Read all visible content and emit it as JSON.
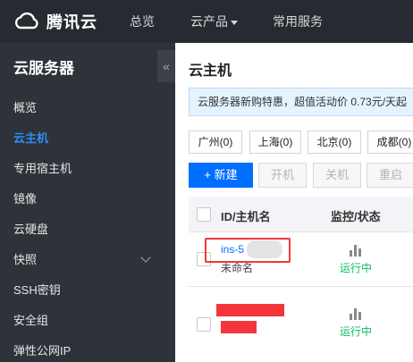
{
  "topbar": {
    "brand": "腾讯云",
    "nav": [
      "总览",
      "云产品",
      "常用服务"
    ]
  },
  "sidebar": {
    "title": "云服务器",
    "collapse_icon": "«",
    "items": [
      {
        "label": "概览",
        "active": false
      },
      {
        "label": "云主机",
        "active": true
      },
      {
        "label": "专用宿主机",
        "active": false
      },
      {
        "label": "镜像",
        "active": false
      },
      {
        "label": "云硬盘",
        "active": false
      },
      {
        "label": "快照",
        "active": false,
        "has_submenu": true
      },
      {
        "label": "SSH密钥",
        "active": false
      },
      {
        "label": "安全组",
        "active": false
      },
      {
        "label": "弹性公网IP",
        "active": false
      }
    ]
  },
  "main": {
    "title": "云主机",
    "promo": "云服务器新购特惠，超值活动价 0.73元/天起",
    "regions": [
      "广州(0)",
      "上海(0)",
      "北京(0)",
      "成都(0)"
    ],
    "actions": {
      "new": "+ 新建",
      "start": "开机",
      "stop": "关机",
      "restart": "重启"
    },
    "table": {
      "headers": [
        "ID/主机名",
        "监控/状态"
      ],
      "rows": [
        {
          "id": "ins-5",
          "name": "未命名",
          "status": "运行中"
        },
        {
          "id": "",
          "name": "",
          "status": "运行中"
        }
      ]
    }
  },
  "colors": {
    "accent": "#006eff",
    "topbar": "#262a31",
    "sidebar": "#2e3239",
    "status_running": "#0abf5b",
    "redact": "#f2363c"
  }
}
